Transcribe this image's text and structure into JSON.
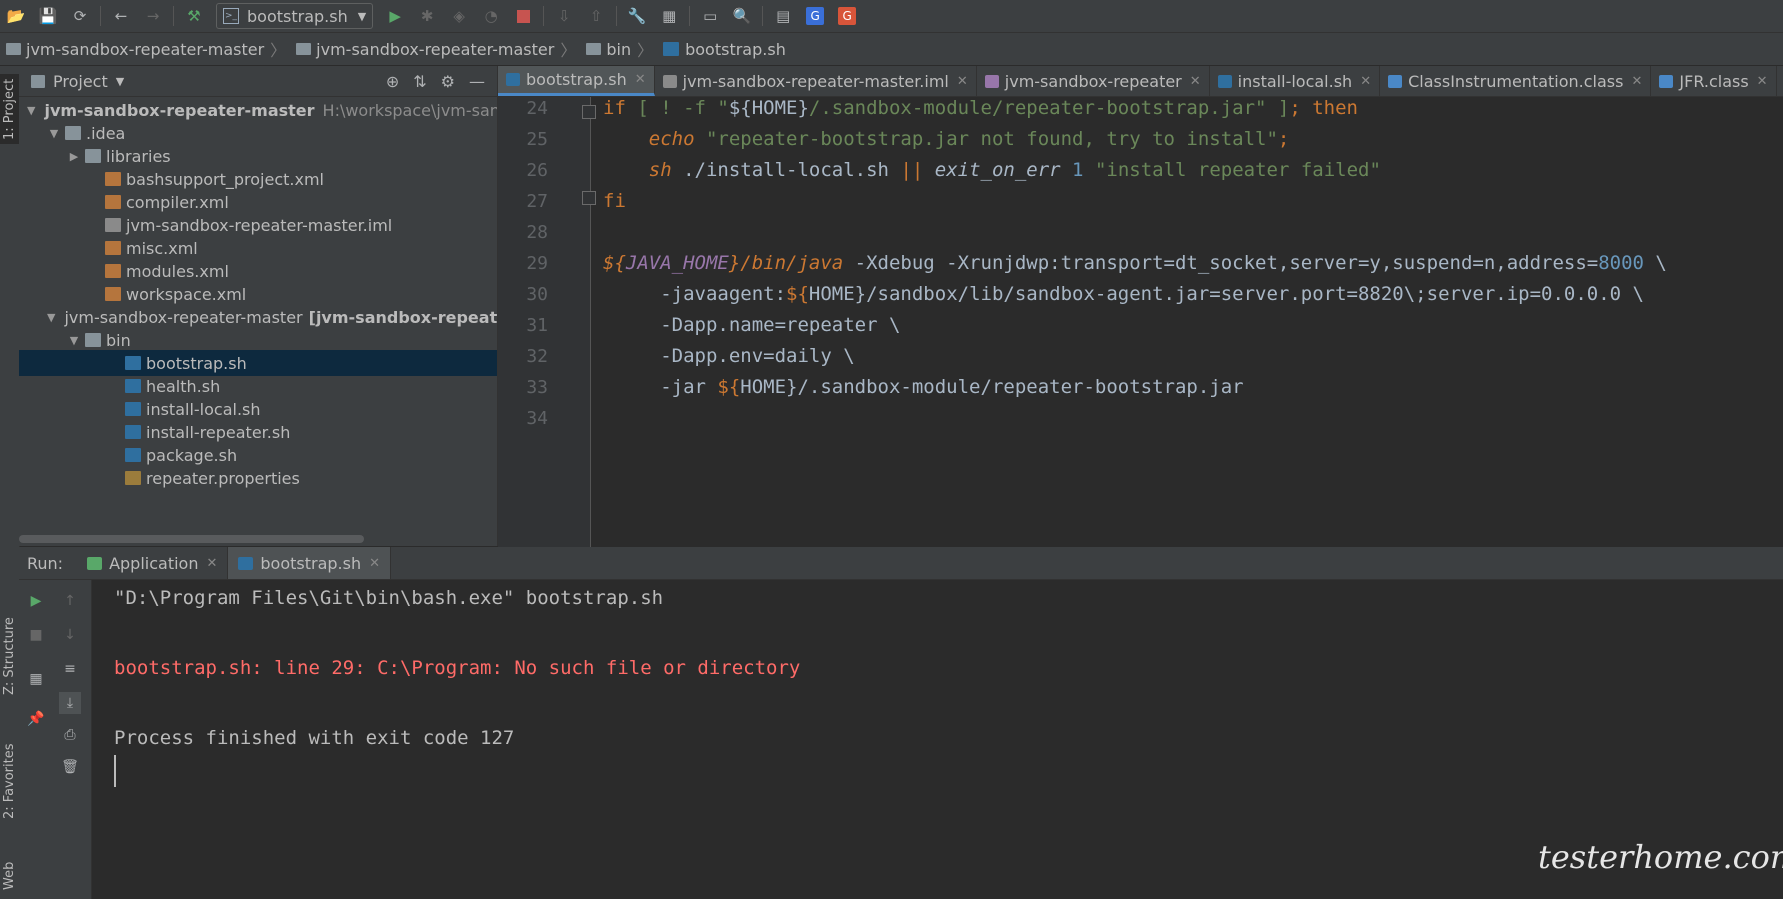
{
  "toolbar": {
    "run_config": "bootstrap.sh"
  },
  "breadcrumb": [
    "jvm-sandbox-repeater-master",
    "jvm-sandbox-repeater-master",
    "bin",
    "bootstrap.sh"
  ],
  "left_strip": {
    "project_tab": "1: Project",
    "structure_tab": "Z: Structure",
    "favorites_tab": "2: Favorites",
    "web_tab": "Web"
  },
  "project_panel": {
    "title": "Project",
    "tree": [
      {
        "label": "jvm-sandbox-repeater-master",
        "path": "H:\\workspace\\jvm-sandbo",
        "depth": 0,
        "arrow": "▼",
        "icon": "module",
        "bold": true
      },
      {
        "label": ".idea",
        "depth": 1,
        "arrow": "▼",
        "icon": "folder"
      },
      {
        "label": "libraries",
        "depth": 2,
        "arrow": "▶",
        "icon": "folder"
      },
      {
        "label": "bashsupport_project.xml",
        "depth": 3,
        "arrow": "",
        "icon": "xml"
      },
      {
        "label": "compiler.xml",
        "depth": 3,
        "arrow": "",
        "icon": "xml"
      },
      {
        "label": "jvm-sandbox-repeater-master.iml",
        "depth": 3,
        "arrow": "",
        "icon": "iml"
      },
      {
        "label": "misc.xml",
        "depth": 3,
        "arrow": "",
        "icon": "xml"
      },
      {
        "label": "modules.xml",
        "depth": 3,
        "arrow": "",
        "icon": "xml"
      },
      {
        "label": "workspace.xml",
        "depth": 3,
        "arrow": "",
        "icon": "xml"
      },
      {
        "label": "jvm-sandbox-repeater-master",
        "suffix": "[jvm-sandbox-repeater]",
        "depth": 1,
        "arrow": "▼",
        "icon": "module"
      },
      {
        "label": "bin",
        "depth": 2,
        "arrow": "▼",
        "icon": "folder"
      },
      {
        "label": "bootstrap.sh",
        "depth": 4,
        "arrow": "",
        "icon": "sh",
        "selected": true
      },
      {
        "label": "health.sh",
        "depth": 4,
        "arrow": "",
        "icon": "sh"
      },
      {
        "label": "install-local.sh",
        "depth": 4,
        "arrow": "",
        "icon": "sh"
      },
      {
        "label": "install-repeater.sh",
        "depth": 4,
        "arrow": "",
        "icon": "sh"
      },
      {
        "label": "package.sh",
        "depth": 4,
        "arrow": "",
        "icon": "sh"
      },
      {
        "label": "repeater.properties",
        "depth": 4,
        "arrow": "",
        "icon": "props"
      }
    ]
  },
  "editor_tabs": [
    {
      "label": "bootstrap.sh",
      "active": true,
      "color": "#2f6f9f"
    },
    {
      "label": "jvm-sandbox-repeater-master.iml",
      "active": false,
      "color": "#8a8a8a"
    },
    {
      "label": "jvm-sandbox-repeater",
      "active": false,
      "color": "#9876aa"
    },
    {
      "label": "install-local.sh",
      "active": false,
      "color": "#2f6f9f"
    },
    {
      "label": "ClassInstrumentation.class",
      "active": false,
      "color": "#4a88c7"
    },
    {
      "label": "JFR.class",
      "active": false,
      "color": "#4a88c7"
    }
  ],
  "code": {
    "line_numbers": [
      "24",
      "25",
      "26",
      "27",
      "28",
      "29",
      "30",
      "31",
      "32",
      "33",
      "34"
    ],
    "lines": [
      [
        {
          "t": "if ",
          "c": "kw"
        },
        {
          "t": "[ ! -f \"",
          "c": "str"
        },
        {
          "t": "${HOME}",
          "c": "plain"
        },
        {
          "t": "/.sandbox-module/repeater-bootstrap.jar\" ]",
          "c": "str"
        },
        {
          "t": "; then",
          "c": "kw"
        }
      ],
      [
        {
          "t": "    "
        },
        {
          "t": "echo",
          "c": "kw it"
        },
        {
          "t": " \"repeater-bootstrap.jar not found, try to install\"",
          "c": "str"
        },
        {
          "t": ";",
          "c": "kw"
        }
      ],
      [
        {
          "t": "    "
        },
        {
          "t": "sh",
          "c": "kw it"
        },
        {
          "t": " ./install-local.sh ",
          "c": "plain"
        },
        {
          "t": "||",
          "c": "kw"
        },
        {
          "t": " exit_on_err",
          "c": "fn"
        },
        {
          "t": " 1",
          "c": "num"
        },
        {
          "t": " \"install repeater failed\"",
          "c": "str"
        }
      ],
      [
        {
          "t": "fi",
          "c": "kw"
        }
      ],
      [],
      [
        {
          "t": "${",
          "c": "kw it"
        },
        {
          "t": "JAVA_HOME",
          "c": "var it"
        },
        {
          "t": "}/bin/java",
          "c": "kw it"
        },
        {
          "t": " -Xdebug -Xrunjdwp:transport=dt_socket,server=y,suspend=n,address=",
          "c": "plain"
        },
        {
          "t": "8000",
          "c": "num"
        },
        {
          "t": " \\",
          "c": "plain"
        }
      ],
      [
        {
          "t": "     -javaagent:",
          "c": "plain"
        },
        {
          "t": "${",
          "c": "kw"
        },
        {
          "t": "HOME}/sandbox/lib/sandbox-agent.jar=server.port=8820\\;server.ip=0.0.0.0 \\",
          "c": "plain"
        }
      ],
      [
        {
          "t": "     -Dapp.name=repeater \\",
          "c": "plain"
        }
      ],
      [
        {
          "t": "     -Dapp.env=daily \\",
          "c": "plain"
        }
      ],
      [
        {
          "t": "     -jar ",
          "c": "plain"
        },
        {
          "t": "${",
          "c": "kw"
        },
        {
          "t": "HOME}/.sandbox-module/repeater-bootstrap.jar",
          "c": "plain"
        }
      ],
      []
    ]
  },
  "run_panel": {
    "label": "Run:",
    "tabs": [
      {
        "label": "Application",
        "active": false
      },
      {
        "label": "bootstrap.sh",
        "active": true
      }
    ],
    "console": [
      {
        "text": "\"D:\\Program Files\\Git\\bin\\bash.exe\" bootstrap.sh",
        "kind": "out"
      },
      {
        "text": "bootstrap.sh: line 29: C:\\Program: No such file or directory",
        "kind": "err"
      },
      {
        "text": "Process finished with exit code 127",
        "kind": "out"
      }
    ]
  },
  "watermark": "testerhome.com"
}
